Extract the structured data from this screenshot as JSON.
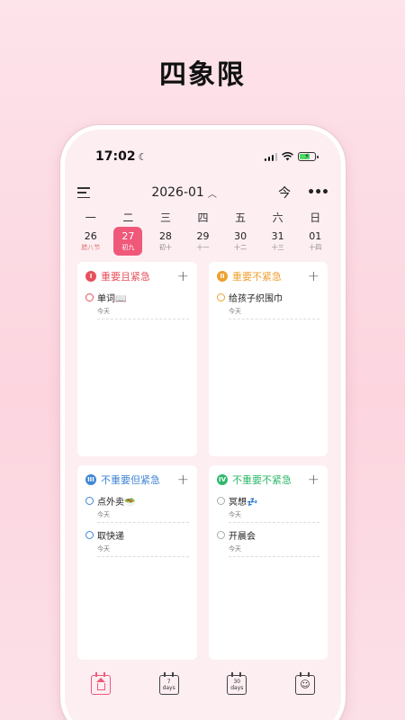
{
  "headline": "四象限",
  "status": {
    "time": "17:02"
  },
  "topbar": {
    "month": "2026-01",
    "today_label": "今",
    "more_label": "•••"
  },
  "weekdays": [
    "一",
    "二",
    "三",
    "四",
    "五",
    "六",
    "日"
  ],
  "dates": [
    {
      "day": "26",
      "lunar": "腊八节"
    },
    {
      "day": "27",
      "lunar": "初九"
    },
    {
      "day": "28",
      "lunar": "初十"
    },
    {
      "day": "29",
      "lunar": "十一"
    },
    {
      "day": "30",
      "lunar": "十二"
    },
    {
      "day": "31",
      "lunar": "十三"
    },
    {
      "day": "01",
      "lunar": "十四"
    }
  ],
  "selected_date_index": 1,
  "quadrants": [
    {
      "badge": "I",
      "title": "重要且紧急",
      "color": "#e8505b",
      "tasks": [
        {
          "text": "单词📖",
          "sub": "今天"
        }
      ]
    },
    {
      "badge": "II",
      "title": "重要不紧急",
      "color": "#f0a030",
      "tasks": [
        {
          "text": "给孩子织围巾",
          "sub": "今天"
        }
      ]
    },
    {
      "badge": "III",
      "title": "不重要但紧急",
      "color": "#3f86d6",
      "tasks": [
        {
          "text": "点外卖🥗",
          "sub": "今天"
        },
        {
          "text": "取快递",
          "sub": "今天"
        }
      ]
    },
    {
      "badge": "IV",
      "title": "不重要不紧急",
      "color": "#2fb86a",
      "tasks": [
        {
          "text": "冥想💤",
          "sub": "今天"
        },
        {
          "text": "开晨会",
          "sub": "今天"
        }
      ]
    }
  ],
  "tabbar": {
    "tab2_num": "7",
    "tab2_unit": "days",
    "tab3_num": "30",
    "tab3_unit": "days",
    "icons": [
      "home-calendar-icon",
      "week-calendar-icon",
      "month-calendar-icon",
      "smile-calendar-icon"
    ]
  },
  "colors": {
    "accent": "#f0587a",
    "background": "#fdeef2"
  }
}
